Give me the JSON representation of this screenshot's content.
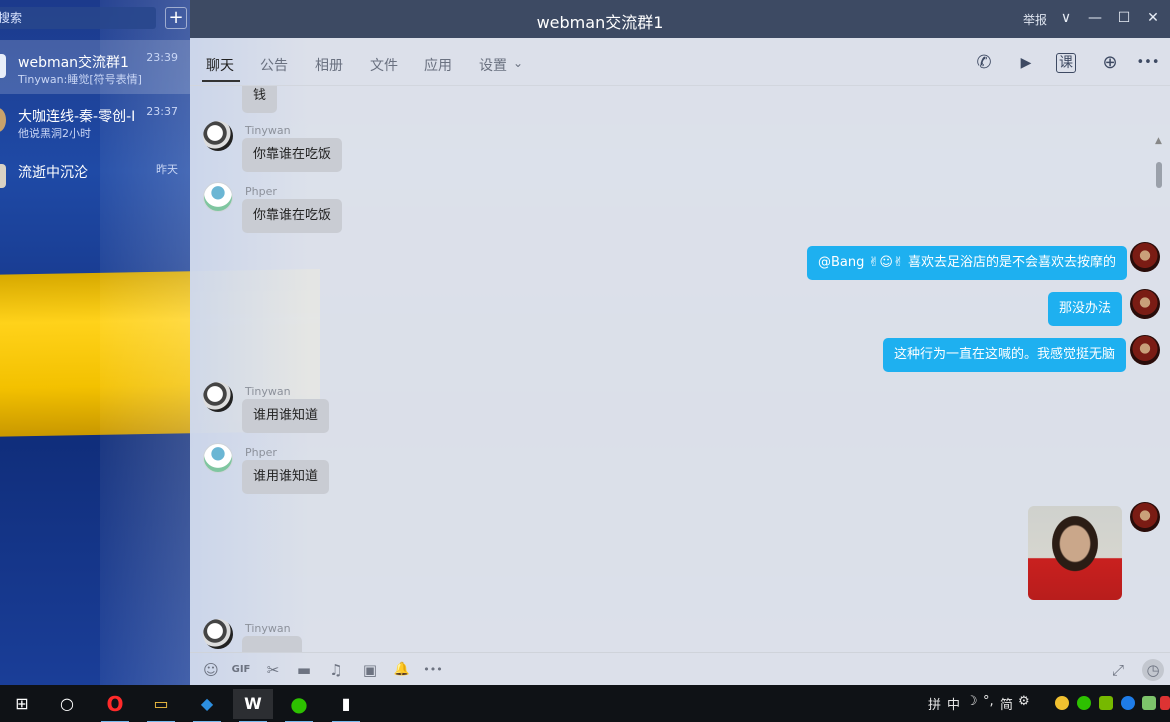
{
  "window": {
    "title": "webman交流群1",
    "report_label": "举报",
    "collapse_label": "∨",
    "minimize_label": "—",
    "maximize_label": "☐",
    "close_label": "✕"
  },
  "sidebar": {
    "search_placeholder": "搜索",
    "add_label": "+",
    "conversations": [
      {
        "name": "webman交流群1",
        "preview": "Tinywan:睡觉[符号表情]",
        "time": "23:39"
      },
      {
        "name": "大咖连线-秦-零创-I",
        "preview": "他说黑洞2小时",
        "time": "23:37"
      },
      {
        "name": "流逝中沉沦",
        "preview": "",
        "time": "昨天"
      }
    ]
  },
  "tabs": [
    "聊天",
    "公告",
    "相册",
    "文件",
    "应用",
    "设置"
  ],
  "tab_dropdown_icon": "⌄",
  "header_icons": [
    "phone-icon",
    "video-icon",
    "class-icon",
    "add-app-icon",
    "more-icon"
  ],
  "header_icon_glyphs": [
    "✆",
    "▶",
    "课",
    "⊕",
    "•••"
  ],
  "messages": [
    {
      "sender": "",
      "text": "钱",
      "side": "in"
    },
    {
      "sender": "Tinywan",
      "text": "你靠谁在吃饭",
      "side": "in"
    },
    {
      "sender": "Phper",
      "text": "你靠谁在吃饭",
      "side": "in"
    },
    {
      "sender": "",
      "text": "@Bang ✌☺✌ 喜欢去足浴店的是不会喜欢去按摩的",
      "side": "out"
    },
    {
      "sender": "",
      "text": "那没办法",
      "side": "out"
    },
    {
      "sender": "",
      "text": "这种行为一直在这喊的。我感觉挺无脑",
      "side": "out"
    },
    {
      "sender": "Tinywan",
      "text": "谁用谁知道",
      "side": "in"
    },
    {
      "sender": "Phper",
      "text": "谁用谁知道",
      "side": "in"
    },
    {
      "sender": "Tinywan",
      "text": "",
      "side": "in"
    }
  ],
  "toolbar_glyphs": [
    "☺",
    "GIF",
    "✂",
    "▬",
    "♫",
    "▣",
    "🔔",
    "•••"
  ],
  "toolbar_right_glyphs": [
    "⤢",
    "◷"
  ],
  "taskbar": {
    "apps": [
      "windows-icon",
      "cortana-icon",
      "opera-icon",
      "explorer-icon",
      "vscode-icon",
      "webman-qq-icon",
      "wechat-icon",
      "terminal-icon"
    ],
    "app_glyphs": [
      "⊞",
      "○",
      "O",
      "▭",
      "◆",
      "W",
      "●",
      "▮"
    ],
    "ime": [
      "拼",
      "中",
      "☽",
      "°,",
      "简",
      "⚙"
    ]
  },
  "colors": {
    "accent": "#1eb0f0",
    "titlebar": "#3d4a63",
    "flag_yellow": "#ffd21a",
    "flag_blue": "#1f4aa6"
  }
}
